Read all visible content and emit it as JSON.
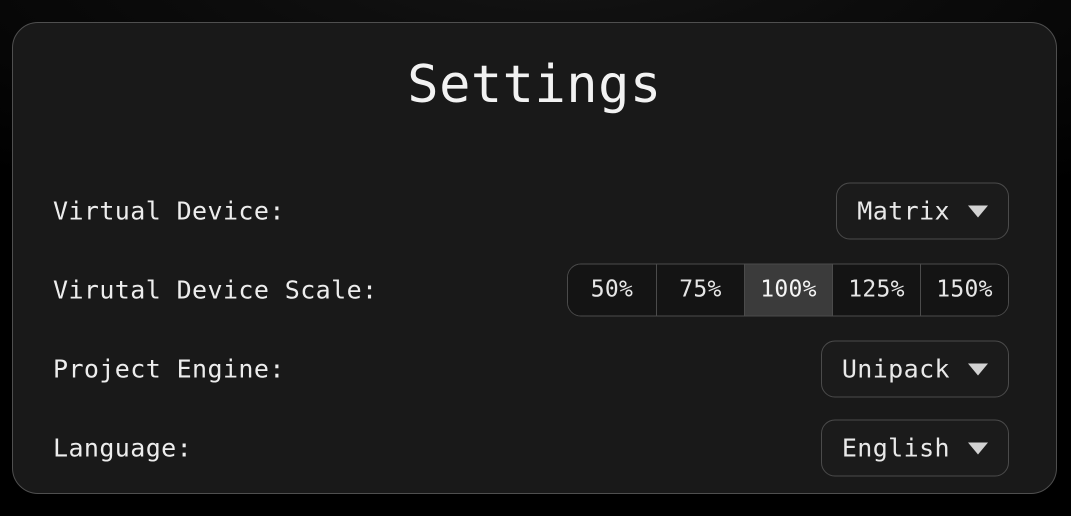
{
  "panel": {
    "title": "Settings"
  },
  "rows": [
    {
      "label": "Virtual Device:",
      "control": "dropdown",
      "value": "Matrix"
    },
    {
      "label": "Virutal Device Scale:",
      "control": "segmented",
      "options": [
        "50%",
        "75%",
        "100%",
        "125%",
        "150%"
      ],
      "selected": "100%"
    },
    {
      "label": "Project Engine:",
      "control": "dropdown",
      "value": "Unipack"
    },
    {
      "label": "Language:",
      "control": "dropdown",
      "value": "English"
    }
  ],
  "icons": {
    "caret": "chevron-down-icon"
  },
  "colors": {
    "page_background": "#000000",
    "panel_background": "#191919",
    "panel_border": "#4f4f4f",
    "control_background": "#1b1b1b",
    "control_border": "#4b4b4b",
    "segment_background": "#141414",
    "segment_selected_background": "#3b3b3b",
    "text_primary": "#ededed",
    "caret_color": "#d2d2d2"
  }
}
